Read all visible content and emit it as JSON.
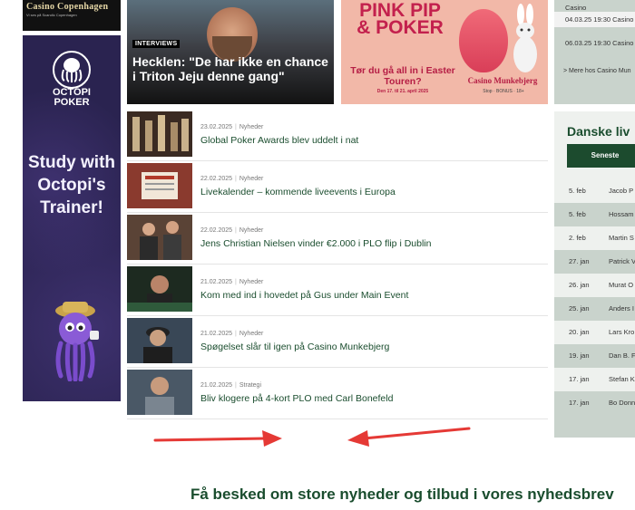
{
  "ads": {
    "casino_copenhagen": {
      "name": "Casino Copenhagen",
      "tag": "Vi ses på Scandic Copenhagen"
    },
    "octopi": {
      "brand_line1": "OCTOPI",
      "brand_line2": "POKER",
      "headline": "Study with Octopi's Trainer!"
    }
  },
  "features": {
    "hecklen": {
      "label": "INTERVIEWS",
      "title": "Hecklen: \"De har ikke en chance i Triton Jeju denne gang\""
    },
    "pink_pip": {
      "headline": "PINK PIP & POKER",
      "subtitle": "Tør du gå all in i Easter Touren?",
      "dates": "Den 17. til 21. april 2025",
      "brand": "Casino Munkebjerg",
      "logos": "Stop · BONUS · 18+"
    }
  },
  "articles": [
    {
      "date": "23.02.2025",
      "category": "Nyheder",
      "title": "Global Poker Awards blev uddelt i nat"
    },
    {
      "date": "22.02.2025",
      "category": "Nyheder",
      "title": "Livekalender – kommende liveevents i Europa"
    },
    {
      "date": "22.02.2025",
      "category": "Nyheder",
      "title": "Jens Christian Nielsen vinder €2.000 i PLO flip i Dublin"
    },
    {
      "date": "21.02.2025",
      "category": "Nyheder",
      "title": "Kom med ind i hovedet på Gus under Main Event"
    },
    {
      "date": "21.02.2025",
      "category": "Nyheder",
      "title": "Spøgelset slår til igen på Casino Munkebjerg"
    },
    {
      "date": "21.02.2025",
      "category": "Strategi",
      "title": "Bliv klogere på 4-kort PLO med Carl Bonefeld"
    }
  ],
  "schedule": {
    "rows": [
      {
        "text": "Casino"
      },
      {
        "text": "04.03.25 19:30   Casino"
      },
      {
        "text": "06.03.25 19:30   Casino"
      }
    ],
    "more": "> Mere hos Casino Mun"
  },
  "live": {
    "title": "Danske liv",
    "button": "Seneste",
    "rows": [
      {
        "date": "5. feb",
        "name": "Jacob P"
      },
      {
        "date": "5. feb",
        "name": "Hossam"
      },
      {
        "date": "2. feb",
        "name": "Martin S"
      },
      {
        "date": "27. jan",
        "name": "Patrick V"
      },
      {
        "date": "26. jan",
        "name": "Murat O"
      },
      {
        "date": "25. jan",
        "name": "Anders I"
      },
      {
        "date": "20. jan",
        "name": "Lars Kro"
      },
      {
        "date": "19. jan",
        "name": "Dan B. F"
      },
      {
        "date": "17. jan",
        "name": "Stefan K"
      },
      {
        "date": "17. jan",
        "name": "Bo Donn"
      }
    ]
  },
  "newsletter": {
    "title": "Få besked om store nyheder og tilbud i vores nyhedsbrev"
  },
  "colors": {
    "brand_green": "#1a4d2e",
    "sidebar_bg": "#c9d3cc",
    "arrow_red": "#e53935"
  }
}
